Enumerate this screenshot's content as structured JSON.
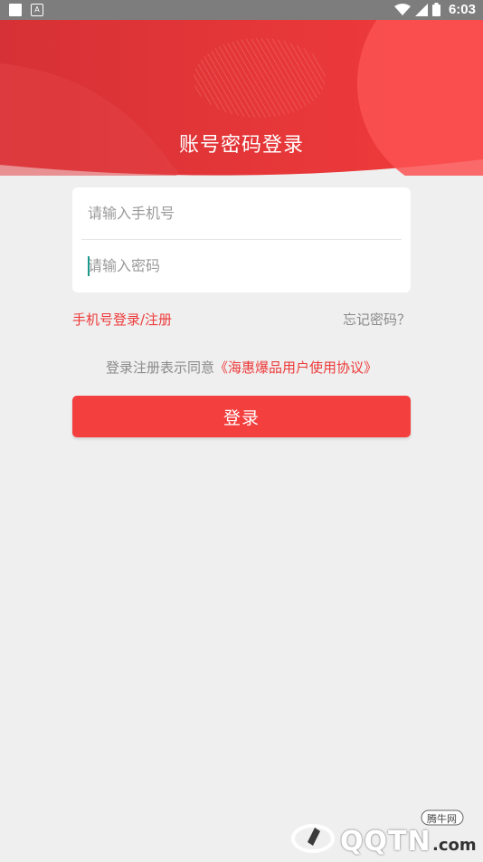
{
  "status_bar": {
    "time": "6:03",
    "left_icons": [
      "square-icon",
      "a-icon"
    ],
    "right_icons": [
      "wifi-icon",
      "signal-icon",
      "battery-icon"
    ]
  },
  "header": {
    "title": "账号密码登录"
  },
  "form": {
    "phone_placeholder": "请输入手机号",
    "password_placeholder": "请输入密码"
  },
  "links": {
    "register": "手机号登录/注册",
    "forgot": "忘记密码？"
  },
  "agreement": {
    "prefix": "登录注册表示同意",
    "protocol": "《海惠爆品用户使用协议》"
  },
  "login_button": "登录",
  "watermark": {
    "text": "QQTN",
    "suffix": ".com",
    "badge": "腾牛网"
  },
  "colors": {
    "primary": "#f43f3f",
    "link": "#ee3a3a",
    "background": "#efefef"
  }
}
